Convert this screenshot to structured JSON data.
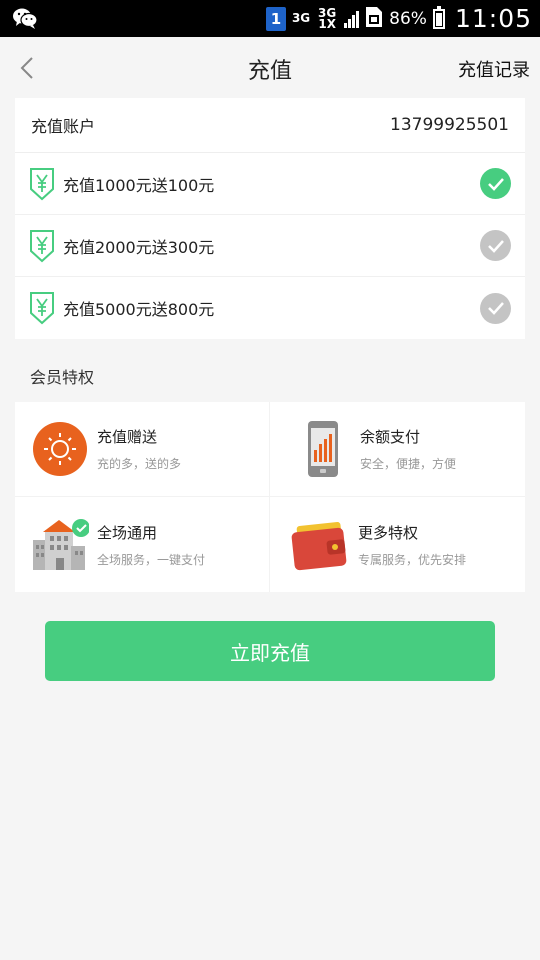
{
  "status_bar": {
    "sim_slot": "1",
    "network_1": "3G",
    "network_2": "3G 1X",
    "battery": "86%",
    "time": "11:05"
  },
  "nav": {
    "title": "充值",
    "record_label": "充值记录"
  },
  "account": {
    "label": "充值账户",
    "number": "13799925501"
  },
  "options": [
    {
      "label": "充值1000元送100元",
      "selected": true
    },
    {
      "label": "充值2000元送300元",
      "selected": false
    },
    {
      "label": "充值5000元送800元",
      "selected": false
    }
  ],
  "privileges": {
    "title": "会员特权",
    "items": [
      {
        "title": "充值赠送",
        "subtitle": "充的多，送的多",
        "icon": "sun-icon"
      },
      {
        "title": "余额支付",
        "subtitle": "安全，便捷，方便",
        "icon": "phone-chart-icon"
      },
      {
        "title": "全场通用",
        "subtitle": "全场服务，一键支付",
        "icon": "building-icon"
      },
      {
        "title": "更多特权",
        "subtitle": "专属服务，优先安排",
        "icon": "wallet-icon"
      }
    ]
  },
  "cta_label": "立即充值",
  "colors": {
    "accent_green": "#47cd80",
    "unchecked_gray": "#c4c4c4",
    "orange": "#e8621e",
    "wallet_red": "#d9473a"
  }
}
